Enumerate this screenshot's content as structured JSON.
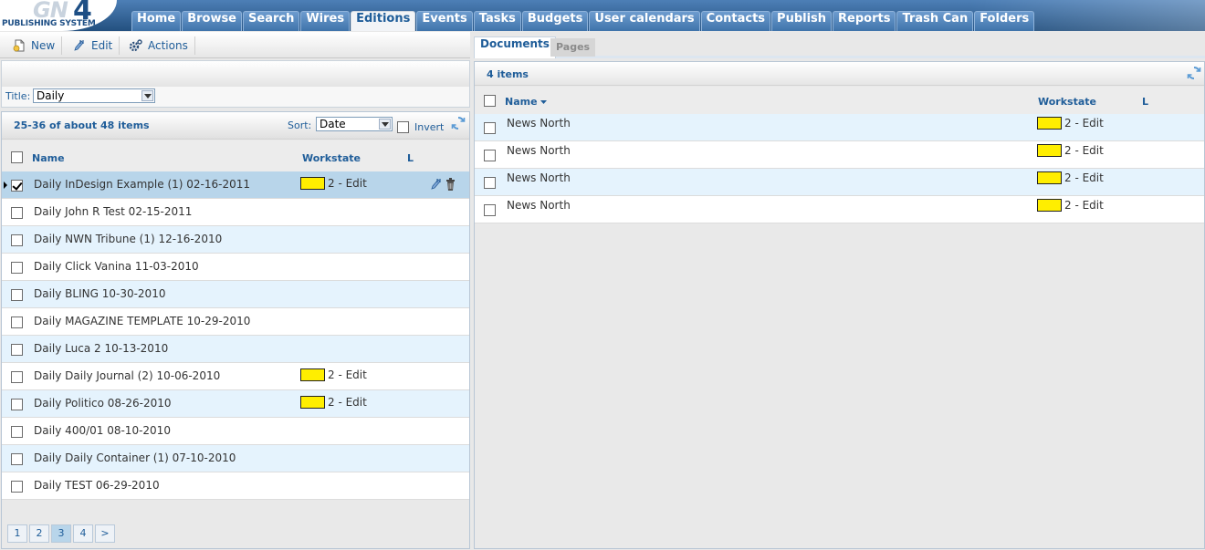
{
  "app": {
    "logo_main": "GN",
    "logo_num": "4",
    "logo_sub": "PUBLISHING SYSTEM"
  },
  "nav": {
    "tabs": [
      {
        "label": "Home"
      },
      {
        "label": "Browse"
      },
      {
        "label": "Search"
      },
      {
        "label": "Wires"
      },
      {
        "label": "Editions",
        "active": true
      },
      {
        "label": "Events"
      },
      {
        "label": "Tasks"
      },
      {
        "label": "Budgets"
      },
      {
        "label": "User calendars"
      },
      {
        "label": "Contacts"
      },
      {
        "label": "Publish"
      },
      {
        "label": "Reports"
      },
      {
        "label": "Trash Can"
      },
      {
        "label": "Folders"
      }
    ]
  },
  "toolbar": {
    "new_label": "New",
    "edit_label": "Edit",
    "actions_label": "Actions"
  },
  "filter": {
    "title_label": "Title:",
    "title_value": "Daily"
  },
  "list": {
    "count": "25-36 of about 48 items",
    "sort_label": "Sort:",
    "sort_value": "Date",
    "invert_label": "Invert",
    "columns": {
      "name": "Name",
      "workstate": "Workstate",
      "l": "L"
    },
    "rows": [
      {
        "name": "Daily InDesign Example (1) 02-16-2011",
        "workstate": "2 - Edit",
        "selected": true,
        "checked": true
      },
      {
        "name": "Daily John R Test 02-15-2011",
        "workstate": ""
      },
      {
        "name": "Daily NWN Tribune (1) 12-16-2010",
        "workstate": ""
      },
      {
        "name": "Daily Click Vanina 11-03-2010",
        "workstate": ""
      },
      {
        "name": "Daily BLING 10-30-2010",
        "workstate": ""
      },
      {
        "name": "Daily MAGAZINE TEMPLATE 10-29-2010",
        "workstate": ""
      },
      {
        "name": "Daily Luca 2 10-13-2010",
        "workstate": ""
      },
      {
        "name": "Daily Daily Journal (2) 10-06-2010",
        "workstate": "2 - Edit"
      },
      {
        "name": "Daily Politico 08-26-2010",
        "workstate": "2 - Edit"
      },
      {
        "name": "Daily 400/01 08-10-2010",
        "workstate": ""
      },
      {
        "name": "Daily Daily Container (1) 07-10-2010",
        "workstate": ""
      },
      {
        "name": "Daily TEST 06-29-2010",
        "workstate": ""
      }
    ],
    "pages": [
      "1",
      "2",
      "3",
      "4",
      ">"
    ],
    "current_page": "3"
  },
  "right": {
    "tabs": {
      "documents": "Documents",
      "pages": "Pages"
    },
    "count": "4 items",
    "columns": {
      "name": "Name",
      "workstate": "Workstate",
      "l": "L"
    },
    "rows": [
      {
        "name": "News North",
        "workstate": "2 - Edit"
      },
      {
        "name": "News North",
        "workstate": "2 - Edit"
      },
      {
        "name": "News North",
        "workstate": "2 - Edit"
      },
      {
        "name": "News North",
        "workstate": "2 - Edit"
      }
    ]
  },
  "colors": {
    "accent": "#1f5d99",
    "workstate_edit": "#ffee00",
    "row_alt": "#e5f3fd",
    "row_selected": "#b8d5ea"
  }
}
